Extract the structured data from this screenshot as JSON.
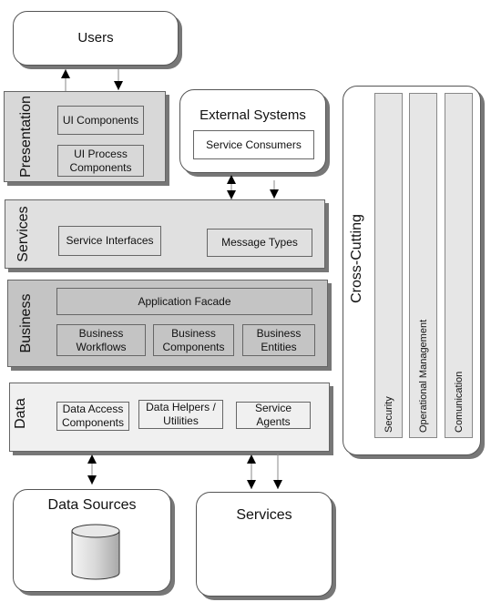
{
  "users": {
    "title": "Users"
  },
  "presentation": {
    "label": "Presentation",
    "components": [
      "UI Components",
      "UI Process\nComponents"
    ]
  },
  "external_systems": {
    "title": "External Systems",
    "components": [
      "Service Consumers"
    ]
  },
  "services_layer": {
    "label": "Services",
    "components": [
      "Service Interfaces",
      "Message Types"
    ]
  },
  "business": {
    "label": "Business",
    "facade": "Application Facade",
    "components": [
      "Business\nWorkflows",
      "Business\nComponents",
      "Business\nEntities"
    ]
  },
  "data_layer": {
    "label": "Data",
    "components": [
      "Data Access\nComponents",
      "Data Helpers /\nUtilities",
      "Service\nAgents"
    ]
  },
  "cross_cutting": {
    "label": "Cross-Cutting",
    "columns": [
      "Security",
      "Operational Management",
      "Comunication"
    ]
  },
  "data_sources": {
    "title": "Data Sources",
    "icon": "database-cylinder-icon"
  },
  "external_services": {
    "title": "Services"
  },
  "colors": {
    "presentation": "#d8d8d8",
    "services": "#e0e0e0",
    "business": "#c4c4c4",
    "data": "#f0f0f0"
  }
}
